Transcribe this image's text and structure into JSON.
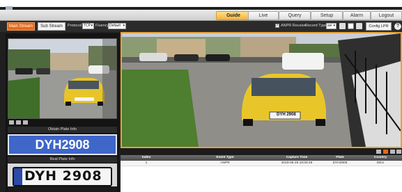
{
  "nav": {
    "tabs": [
      {
        "label": "Guide",
        "active": true
      },
      {
        "label": "Live",
        "active": false
      },
      {
        "label": "Query",
        "active": false
      },
      {
        "label": "Setup",
        "active": false
      },
      {
        "label": "Alarm",
        "active": false
      },
      {
        "label": "Logout",
        "active": false
      }
    ]
  },
  "toolbar": {
    "main_stream": "Main Stream",
    "sub_stream": "Sub Stream",
    "protocol_label": "Protocol",
    "protocol_value": "TCP",
    "fluency_label": "Fluency",
    "fluency_value": "Default",
    "anpr_label": "ANPR Receive",
    "record_type_label": "Record Type",
    "record_type_value": "avi",
    "config_label": "Config LPR",
    "help": "?"
  },
  "left": {
    "obtain_title": "Obtain Plate Info",
    "plate_number": "DYH2908",
    "real_title": "Real Plate Info",
    "crop_text": "DYH 2908"
  },
  "main": {
    "plate_on_car": "DYH 2908",
    "left_plate_on_car": "DYH 2908"
  },
  "table": {
    "columns": [
      "Index",
      "Event Type",
      "Capture Time",
      "Plate",
      "Country"
    ],
    "rows": [
      [
        "1",
        "ANPR",
        "2019-05-29 18:00:49",
        "DYH2908",
        "DEU"
      ]
    ]
  },
  "colors": {
    "accent": "#e66a19",
    "active_tab": "#f3b33d",
    "plate_blue": "#3f66c9",
    "frame": "#e5a23b"
  }
}
